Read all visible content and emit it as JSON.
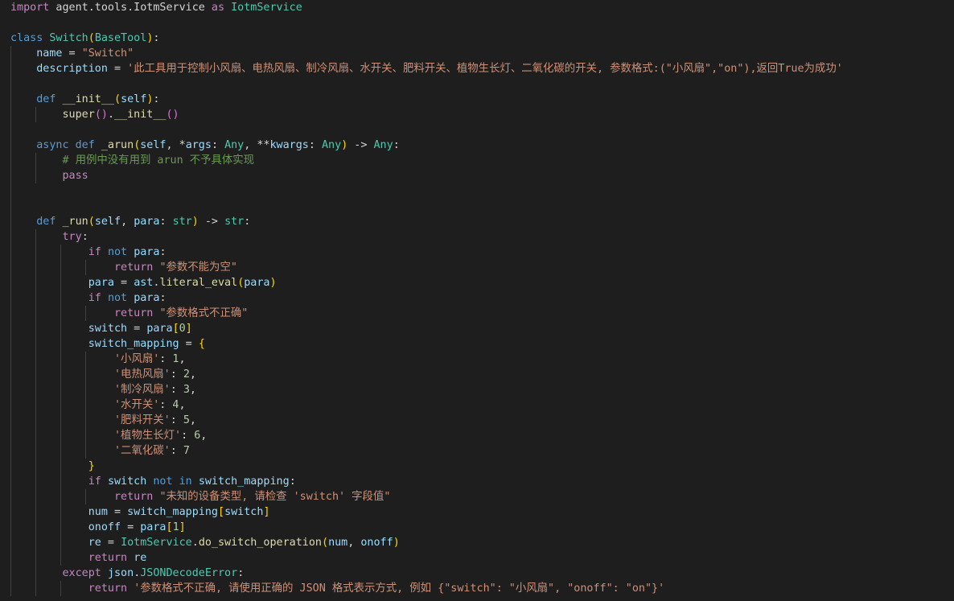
{
  "colors": {
    "background": "#1e1e1e",
    "text": "#d4d4d4",
    "keyword_control": "#c586c0",
    "keyword_storage": "#569cd6",
    "function": "#dcdcaa",
    "class": "#4ec9b0",
    "variable": "#9cdcfe",
    "string": "#ce9178",
    "number": "#b5cea8",
    "comment": "#6a9955",
    "bracket_1": "#ffd700",
    "bracket_2": "#da70d6",
    "bracket_3": "#179fff"
  },
  "code_lines": [
    [
      [
        "kw",
        "import"
      ],
      [
        "pl",
        " agent.tools.IotmService "
      ],
      [
        "kw",
        "as"
      ],
      [
        "pl",
        " "
      ],
      [
        "cls",
        "IotmService"
      ]
    ],
    [],
    [
      [
        "st",
        "class"
      ],
      [
        "pl",
        " "
      ],
      [
        "cls",
        "Switch"
      ],
      [
        "b1",
        "("
      ],
      [
        "cls",
        "BaseTool"
      ],
      [
        "b1",
        ")"
      ],
      [
        "pl",
        ":"
      ]
    ],
    [
      [
        "pl",
        "    "
      ],
      [
        "var",
        "name"
      ],
      [
        "pl",
        " = "
      ],
      [
        "str",
        "\"Switch\""
      ]
    ],
    [
      [
        "pl",
        "    "
      ],
      [
        "var",
        "description"
      ],
      [
        "pl",
        " = "
      ],
      [
        "str",
        "'此工具用于控制小风扇、电热风扇、制冷风扇、水开关、肥料开关、植物生长灯、二氧化碳的开关, 参数格式:(\"小风扇\",\"on\"),返回True为成功'"
      ]
    ],
    [],
    [
      [
        "pl",
        "    "
      ],
      [
        "st",
        "def"
      ],
      [
        "pl",
        " "
      ],
      [
        "fn",
        "__init__"
      ],
      [
        "b1",
        "("
      ],
      [
        "var",
        "self"
      ],
      [
        "b1",
        ")"
      ],
      [
        "pl",
        ":"
      ]
    ],
    [
      [
        "pl",
        "        "
      ],
      [
        "fn",
        "super"
      ],
      [
        "b2",
        "()"
      ],
      [
        "pl",
        "."
      ],
      [
        "fn",
        "__init__"
      ],
      [
        "b2",
        "()"
      ]
    ],
    [],
    [
      [
        "pl",
        "    "
      ],
      [
        "st",
        "async"
      ],
      [
        "pl",
        " "
      ],
      [
        "st",
        "def"
      ],
      [
        "pl",
        " "
      ],
      [
        "fn",
        "_arun"
      ],
      [
        "b1",
        "("
      ],
      [
        "var",
        "self"
      ],
      [
        "pl",
        ", *"
      ],
      [
        "var",
        "args"
      ],
      [
        "pl",
        ": "
      ],
      [
        "cls",
        "Any"
      ],
      [
        "pl",
        ", **"
      ],
      [
        "var",
        "kwargs"
      ],
      [
        "pl",
        ": "
      ],
      [
        "cls",
        "Any"
      ],
      [
        "b1",
        ")"
      ],
      [
        "pl",
        " -> "
      ],
      [
        "cls",
        "Any"
      ],
      [
        "pl",
        ":"
      ]
    ],
    [
      [
        "pl",
        "        "
      ],
      [
        "cmt",
        "# 用例中没有用到 arun 不予具体实现"
      ]
    ],
    [
      [
        "pl",
        "        "
      ],
      [
        "kw",
        "pass"
      ]
    ],
    [],
    [],
    [
      [
        "pl",
        "    "
      ],
      [
        "st",
        "def"
      ],
      [
        "pl",
        " "
      ],
      [
        "fn",
        "_run"
      ],
      [
        "b1",
        "("
      ],
      [
        "var",
        "self"
      ],
      [
        "pl",
        ", "
      ],
      [
        "var",
        "para"
      ],
      [
        "pl",
        ": "
      ],
      [
        "cls",
        "str"
      ],
      [
        "b1",
        ")"
      ],
      [
        "pl",
        " -> "
      ],
      [
        "cls",
        "str"
      ],
      [
        "pl",
        ":"
      ]
    ],
    [
      [
        "pl",
        "        "
      ],
      [
        "kw",
        "try"
      ],
      [
        "pl",
        ":"
      ]
    ],
    [
      [
        "pl",
        "            "
      ],
      [
        "kw",
        "if"
      ],
      [
        "pl",
        " "
      ],
      [
        "st",
        "not"
      ],
      [
        "pl",
        " "
      ],
      [
        "var",
        "para"
      ],
      [
        "pl",
        ":"
      ]
    ],
    [
      [
        "pl",
        "                "
      ],
      [
        "kw",
        "return"
      ],
      [
        "pl",
        " "
      ],
      [
        "str",
        "\"参数不能为空\""
      ]
    ],
    [
      [
        "pl",
        "            "
      ],
      [
        "var",
        "para"
      ],
      [
        "pl",
        " = "
      ],
      [
        "var",
        "ast"
      ],
      [
        "pl",
        "."
      ],
      [
        "fn",
        "literal_eval"
      ],
      [
        "b1",
        "("
      ],
      [
        "var",
        "para"
      ],
      [
        "b1",
        ")"
      ]
    ],
    [
      [
        "pl",
        "            "
      ],
      [
        "kw",
        "if"
      ],
      [
        "pl",
        " "
      ],
      [
        "st",
        "not"
      ],
      [
        "pl",
        " "
      ],
      [
        "var",
        "para"
      ],
      [
        "pl",
        ":"
      ]
    ],
    [
      [
        "pl",
        "                "
      ],
      [
        "kw",
        "return"
      ],
      [
        "pl",
        " "
      ],
      [
        "str",
        "\"参数格式不正确\""
      ]
    ],
    [
      [
        "pl",
        "            "
      ],
      [
        "var",
        "switch"
      ],
      [
        "pl",
        " = "
      ],
      [
        "var",
        "para"
      ],
      [
        "b1",
        "["
      ],
      [
        "num",
        "0"
      ],
      [
        "b1",
        "]"
      ]
    ],
    [
      [
        "pl",
        "            "
      ],
      [
        "var",
        "switch_mapping"
      ],
      [
        "pl",
        " = "
      ],
      [
        "b1",
        "{"
      ]
    ],
    [
      [
        "pl",
        "                "
      ],
      [
        "str",
        "'小风扇'"
      ],
      [
        "pl",
        ": "
      ],
      [
        "num",
        "1"
      ],
      [
        "pl",
        ","
      ]
    ],
    [
      [
        "pl",
        "                "
      ],
      [
        "str",
        "'电热风扇'"
      ],
      [
        "pl",
        ": "
      ],
      [
        "num",
        "2"
      ],
      [
        "pl",
        ","
      ]
    ],
    [
      [
        "pl",
        "                "
      ],
      [
        "str",
        "'制冷风扇'"
      ],
      [
        "pl",
        ": "
      ],
      [
        "num",
        "3"
      ],
      [
        "pl",
        ","
      ]
    ],
    [
      [
        "pl",
        "                "
      ],
      [
        "str",
        "'水开关'"
      ],
      [
        "pl",
        ": "
      ],
      [
        "num",
        "4"
      ],
      [
        "pl",
        ","
      ]
    ],
    [
      [
        "pl",
        "                "
      ],
      [
        "str",
        "'肥料开关'"
      ],
      [
        "pl",
        ": "
      ],
      [
        "num",
        "5"
      ],
      [
        "pl",
        ","
      ]
    ],
    [
      [
        "pl",
        "                "
      ],
      [
        "str",
        "'植物生长灯'"
      ],
      [
        "pl",
        ": "
      ],
      [
        "num",
        "6"
      ],
      [
        "pl",
        ","
      ]
    ],
    [
      [
        "pl",
        "                "
      ],
      [
        "str",
        "'二氧化碳'"
      ],
      [
        "pl",
        ": "
      ],
      [
        "num",
        "7"
      ]
    ],
    [
      [
        "pl",
        "            "
      ],
      [
        "b1",
        "}"
      ]
    ],
    [
      [
        "pl",
        "            "
      ],
      [
        "kw",
        "if"
      ],
      [
        "pl",
        " "
      ],
      [
        "var",
        "switch"
      ],
      [
        "pl",
        " "
      ],
      [
        "st",
        "not"
      ],
      [
        "pl",
        " "
      ],
      [
        "st",
        "in"
      ],
      [
        "pl",
        " "
      ],
      [
        "var",
        "switch_mapping"
      ],
      [
        "pl",
        ":"
      ]
    ],
    [
      [
        "pl",
        "                "
      ],
      [
        "kw",
        "return"
      ],
      [
        "pl",
        " "
      ],
      [
        "str",
        "\"未知的设备类型, 请检查 'switch' 字段值\""
      ]
    ],
    [
      [
        "pl",
        "            "
      ],
      [
        "var",
        "num"
      ],
      [
        "pl",
        " = "
      ],
      [
        "var",
        "switch_mapping"
      ],
      [
        "b1",
        "["
      ],
      [
        "var",
        "switch"
      ],
      [
        "b1",
        "]"
      ]
    ],
    [
      [
        "pl",
        "            "
      ],
      [
        "var",
        "onoff"
      ],
      [
        "pl",
        " = "
      ],
      [
        "var",
        "para"
      ],
      [
        "b1",
        "["
      ],
      [
        "num",
        "1"
      ],
      [
        "b1",
        "]"
      ]
    ],
    [
      [
        "pl",
        "            "
      ],
      [
        "var",
        "re"
      ],
      [
        "pl",
        " = "
      ],
      [
        "cls",
        "IotmService"
      ],
      [
        "pl",
        "."
      ],
      [
        "fn",
        "do_switch_operation"
      ],
      [
        "b1",
        "("
      ],
      [
        "var",
        "num"
      ],
      [
        "pl",
        ", "
      ],
      [
        "var",
        "onoff"
      ],
      [
        "b1",
        ")"
      ]
    ],
    [
      [
        "pl",
        "            "
      ],
      [
        "kw",
        "return"
      ],
      [
        "pl",
        " "
      ],
      [
        "var",
        "re"
      ]
    ],
    [
      [
        "pl",
        "        "
      ],
      [
        "kw",
        "except"
      ],
      [
        "pl",
        " "
      ],
      [
        "var",
        "json"
      ],
      [
        "pl",
        "."
      ],
      [
        "cls",
        "JSONDecodeError"
      ],
      [
        "pl",
        ":"
      ]
    ],
    [
      [
        "pl",
        "            "
      ],
      [
        "kw",
        "return"
      ],
      [
        "pl",
        " "
      ],
      [
        "str",
        "'参数格式不正确, 请使用正确的 JSON 格式表示方式, 例如 {\"switch\": \"小风扇\", \"onoff\": \"on\"}'"
      ]
    ]
  ]
}
